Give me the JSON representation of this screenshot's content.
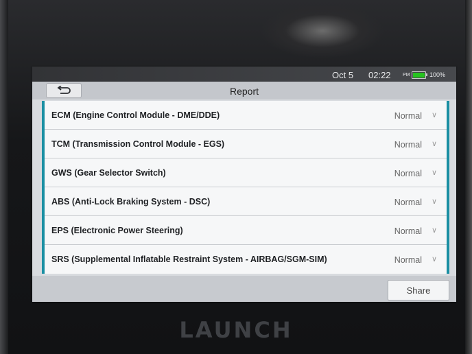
{
  "status_bar": {
    "date": "Oct 5",
    "time": "02:22",
    "ampm": "PM",
    "battery_percent_label": "100%",
    "battery_level": 1.0,
    "battery_color": "#26c31f"
  },
  "header": {
    "title": "Report",
    "back_icon": "back-arrow-icon"
  },
  "systems": [
    {
      "label": "ECM (Engine Control Module - DME/DDE)",
      "status": "Normal"
    },
    {
      "label": "TCM (Transmission Control Module - EGS)",
      "status": "Normal"
    },
    {
      "label": "GWS (Gear Selector Switch)",
      "status": "Normal"
    },
    {
      "label": "ABS (Anti-Lock Braking System - DSC)",
      "status": "Normal"
    },
    {
      "label": "EPS (Electronic Power Steering)",
      "status": "Normal"
    },
    {
      "label": "SRS (Supplemental Inflatable Restraint System - AIRBAG/SGM-SIM)",
      "status": "Normal"
    }
  ],
  "footer": {
    "share_label": "Share"
  },
  "device": {
    "brand": "LAUNCH"
  },
  "colors": {
    "accent": "#1a8fa3"
  }
}
